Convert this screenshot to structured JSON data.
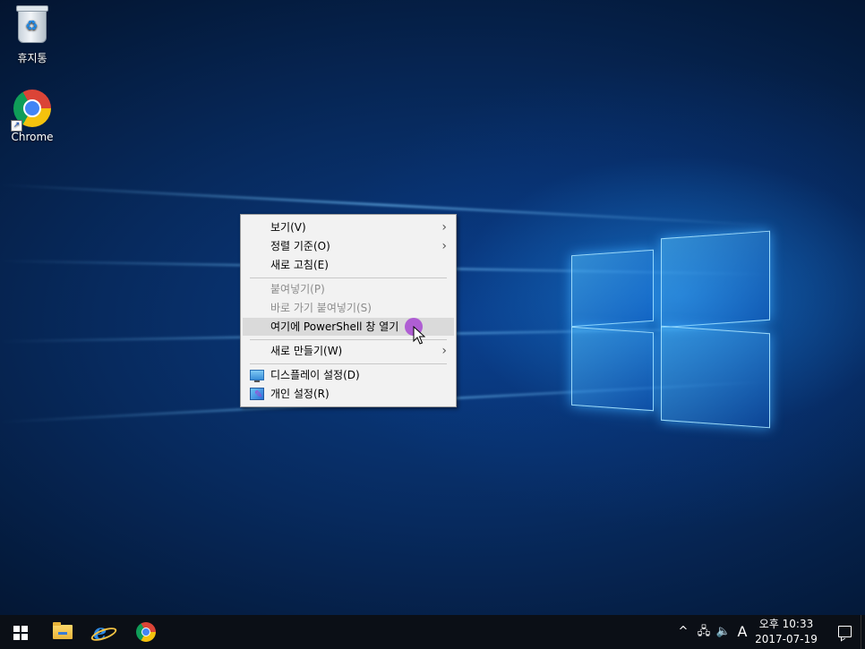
{
  "desktop": {
    "icons": [
      {
        "label": "휴지통",
        "icon": "recycle-bin-icon"
      },
      {
        "label": "Chrome",
        "icon": "chrome-icon"
      }
    ]
  },
  "context_menu": {
    "items": [
      {
        "label": "보기(V)",
        "submenu": true,
        "disabled": false
      },
      {
        "label": "정렬 기준(O)",
        "submenu": true,
        "disabled": false
      },
      {
        "label": "새로 고침(E)",
        "submenu": false,
        "disabled": false
      },
      {
        "label": "붙여넣기(P)",
        "submenu": false,
        "disabled": true
      },
      {
        "label": "바로 가기 붙여넣기(S)",
        "submenu": false,
        "disabled": true
      },
      {
        "label": "여기에 PowerShell 창 열기",
        "submenu": false,
        "disabled": false,
        "highlighted": true
      },
      {
        "label": "새로 만들기(W)",
        "submenu": true,
        "disabled": false
      },
      {
        "label": "디스플레이 설정(D)",
        "submenu": false,
        "disabled": false,
        "icon": "display-settings-icon"
      },
      {
        "label": "개인 설정(R)",
        "submenu": false,
        "disabled": false,
        "icon": "personalize-icon"
      }
    ],
    "submenu_glyph": "›"
  },
  "taskbar": {
    "pinned": [
      "start-icon",
      "file-explorer-icon",
      "internet-explorer-icon",
      "chrome-icon"
    ],
    "tray": {
      "chevron": "^",
      "network_glyph": "🖧",
      "volume_glyph": "🔈",
      "ime": "A"
    },
    "clock": {
      "time": "오후 10:33",
      "date": "2017-07-19"
    }
  },
  "colors": {
    "accent": "#0078d7",
    "taskbar": "#0b0f16",
    "menu_bg": "#f2f2f2",
    "cursor_highlight": "#aa50d2"
  }
}
